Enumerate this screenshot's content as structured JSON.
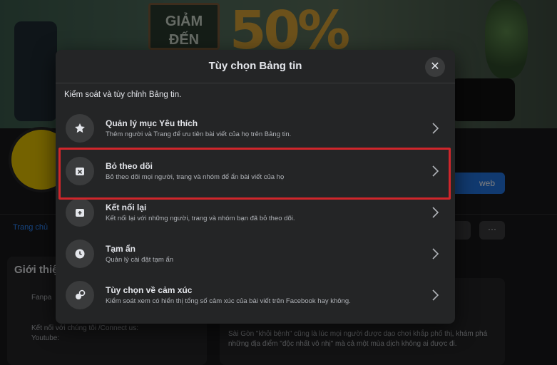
{
  "background": {
    "promo_board_text": "GIẢM ĐẾN",
    "promo_big_text": "50%",
    "web_button_label": "web",
    "tab_label": "Trang chủ",
    "about_heading": "Giới thiệu",
    "left_item_1": "Fanpa",
    "left_item_2": "Kết nối với chúng tôi /Connect us:",
    "left_item_3": "Youtube:",
    "post_text": "Sài Gòn \"khỏi bệnh\" cũng là lúc mọi người được dạo chơi khắp phố thị, khám phá những địa điểm \"độc nhất vô nhị\" mà cả một mùa dịch không ai được đi.",
    "more_label": "···"
  },
  "modal": {
    "title": "Tùy chọn Bảng tin",
    "close_label": "✕",
    "description": "Kiểm soát và tùy chỉnh Bảng tin.",
    "options": [
      {
        "icon": "star-icon",
        "title": "Quản lý mục Yêu thích",
        "subtitle": "Thêm người và Trang để ưu tiên bài viết của họ trên Bảng tin."
      },
      {
        "icon": "unfollow-icon",
        "title": "Bỏ theo dõi",
        "subtitle": "Bỏ theo dõi mọi người, trang và nhóm để ẩn bài viết của họ"
      },
      {
        "icon": "reconnect-icon",
        "title": "Kết nối lại",
        "subtitle": "Kết nối lại với những người, trang và nhóm bạn đã bỏ theo dõi."
      },
      {
        "icon": "clock-icon",
        "title": "Tạm ẩn",
        "subtitle": "Quản lý cài đặt tạm ẩn"
      },
      {
        "icon": "reactions-icon",
        "title": "Tùy chọn về cảm xúc",
        "subtitle": "Kiểm soát xem có hiển thị tổng số cảm xúc của bài viết trên Facebook hay không."
      }
    ]
  },
  "colors": {
    "modal_bg": "#242526",
    "highlight": "#d0262b",
    "accent": "#2374e1"
  }
}
